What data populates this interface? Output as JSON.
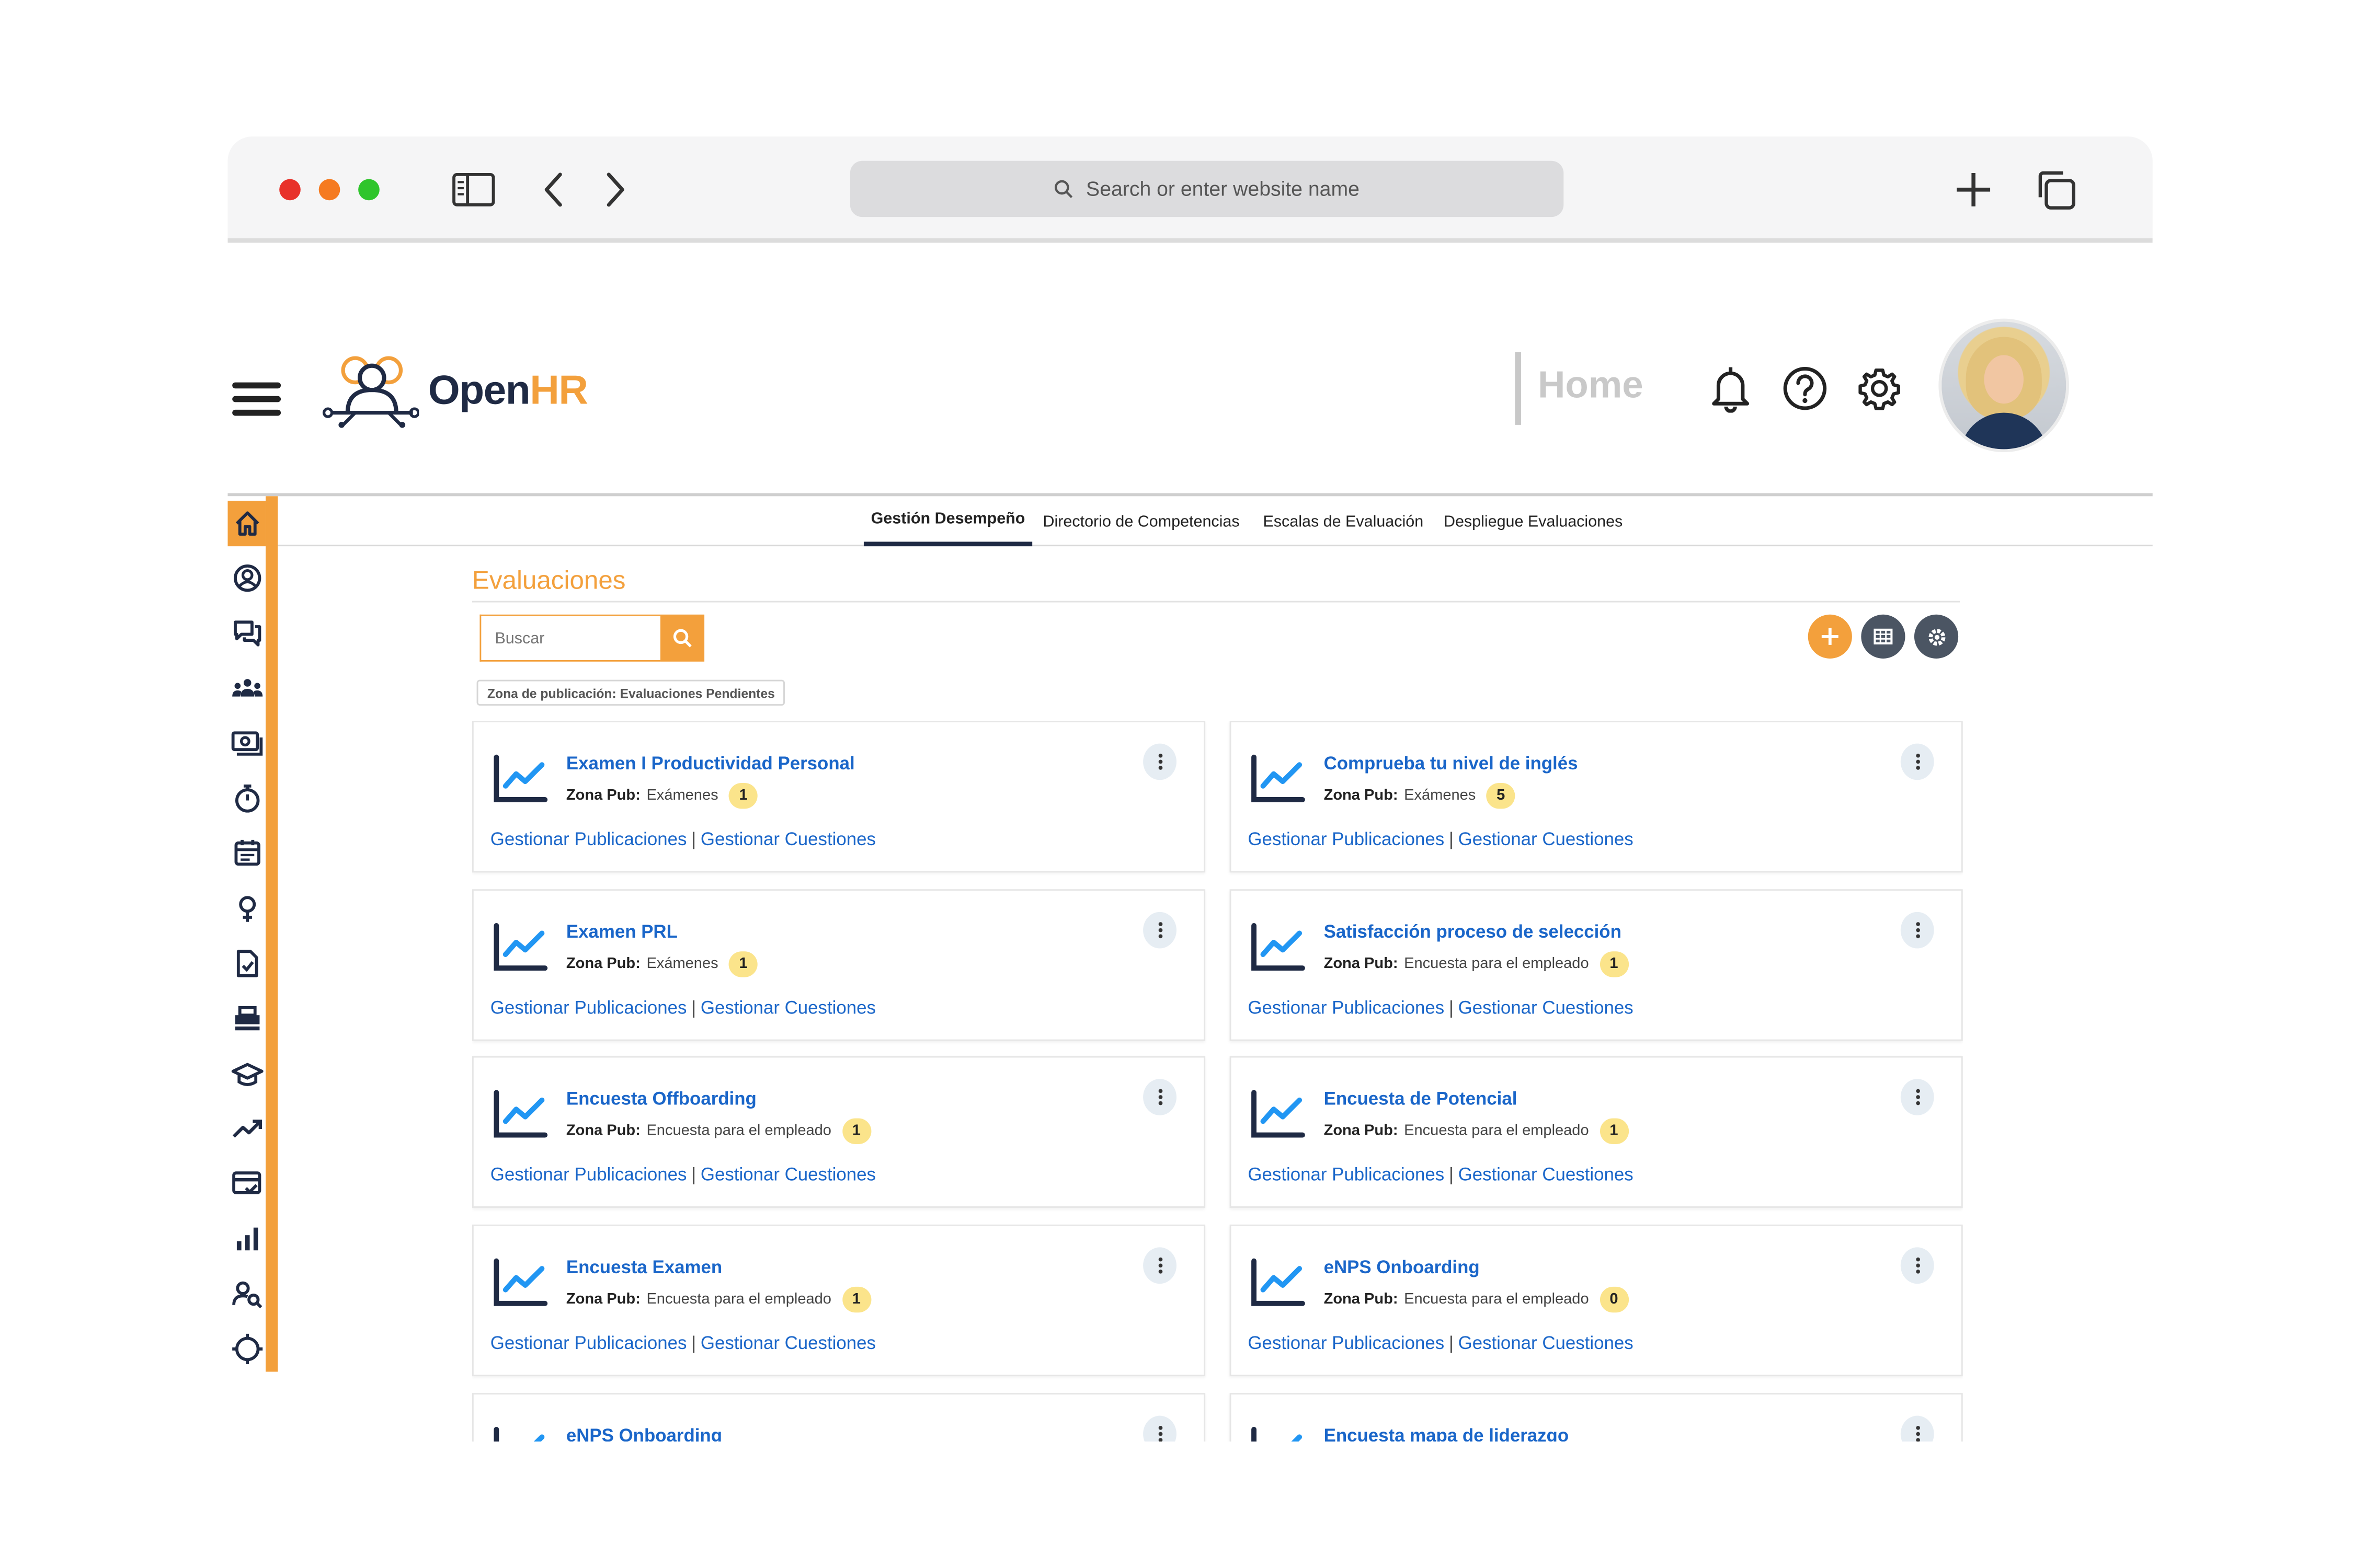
{
  "browser": {
    "address_placeholder": "Search or enter website name"
  },
  "app": {
    "logo_open": "Open",
    "logo_hr": "HR",
    "home_label": "Home"
  },
  "tabs": [
    {
      "label": "Gestión Desempeño",
      "active": true
    },
    {
      "label": "Directorio de Competencias",
      "active": false
    },
    {
      "label": "Escalas de Evaluación",
      "active": false
    },
    {
      "label": "Despliegue Evaluaciones",
      "active": false
    }
  ],
  "section": {
    "title": "Evaluaciones",
    "search_placeholder": "Buscar",
    "filter_chip": "Zona de publicación: Evaluaciones Pendientes"
  },
  "colors": {
    "accent": "#f3a03c",
    "link": "#1a66c9",
    "dark": "#1f2a44"
  },
  "sidebar_icons": [
    "home-icon",
    "user-circle-icon",
    "chat-icon",
    "team-icon",
    "money-icon",
    "stopwatch-icon",
    "calendar-icon",
    "female-icon",
    "document-check-icon",
    "printer-icon",
    "graduation-cap-icon",
    "trend-up-icon",
    "card-check-icon",
    "bar-chart-icon",
    "user-search-icon",
    "target-icon"
  ],
  "card_common": {
    "zone_label": "Zona Pub:",
    "link_publications": "Gestionar Publicaciones",
    "link_separator": "|",
    "link_questions": "Gestionar Cuestiones"
  },
  "cards": [
    {
      "title": "Examen I Productividad Personal",
      "zone": "Exámenes",
      "count": "1"
    },
    {
      "title": "Comprueba tu nivel de inglés",
      "zone": "Exámenes",
      "count": "5"
    },
    {
      "title": "Examen PRL",
      "zone": "Exámenes",
      "count": "1"
    },
    {
      "title": "Satisfacción proceso de selección",
      "zone": "Encuesta para el empleado",
      "count": "1"
    },
    {
      "title": "Encuesta Offboarding",
      "zone": "Encuesta para el empleado",
      "count": "1"
    },
    {
      "title": "Encuesta de Potencial",
      "zone": "Encuesta para el empleado",
      "count": "1"
    },
    {
      "title": "Encuesta Examen",
      "zone": "Encuesta para el empleado",
      "count": "1"
    },
    {
      "title": "eNPS Onboarding",
      "zone": "Encuesta para el empleado",
      "count": "0"
    },
    {
      "title": "eNPS Onboarding",
      "zone": "",
      "count": ""
    },
    {
      "title": "Encuesta mapa de liderazgo",
      "zone": "",
      "count": ""
    }
  ]
}
